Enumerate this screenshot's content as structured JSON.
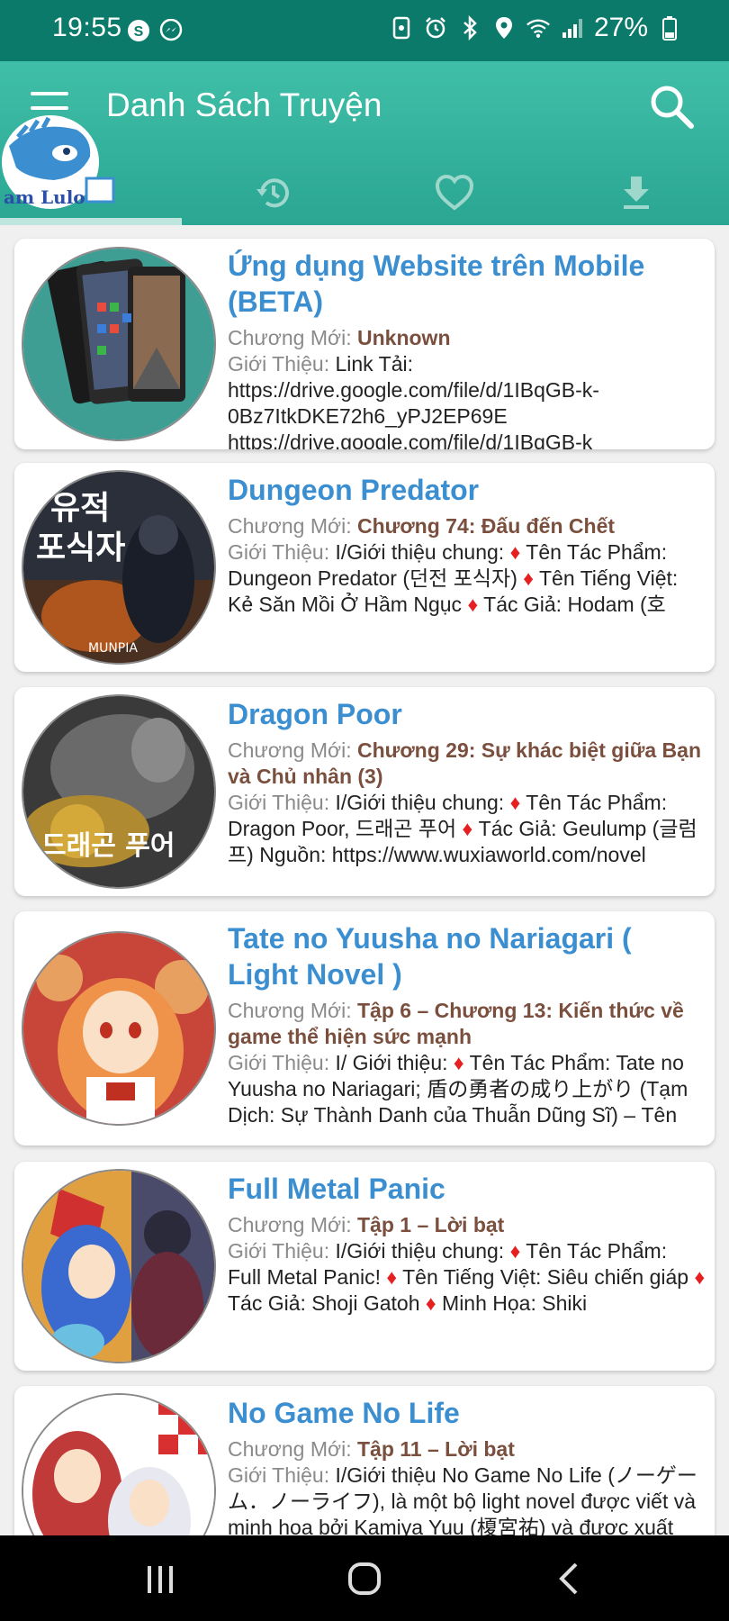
{
  "status_bar": {
    "time": "19:55",
    "battery": "27%",
    "left_icons": [
      "skype-icon",
      "messenger-icon"
    ],
    "right_icons": [
      "vibrate-icon",
      "alarm-icon",
      "bluetooth-icon",
      "location-icon",
      "wifi-icon",
      "signal-icon",
      "battery-icon"
    ]
  },
  "app_bar": {
    "title": "Danh Sách Truyện",
    "logo_text": "am Lulo",
    "tabs": [
      "home-icon",
      "history-icon",
      "favorite-icon",
      "download-icon"
    ]
  },
  "stories": [
    {
      "title": "Ứng dụng Website trên Mobile (BETA)",
      "latest_label": "Chương Mới: ",
      "latest": "Unknown",
      "intro_label": "Giới Thiệu: ",
      "intro": "Link Tải: https://drive.google.com/file/d/1IBqGB-k-0Bz7ItkDKE72h6_yPJ2EP69E https://drive.google.com/file/d/1IBqGB-k"
    },
    {
      "title": "Dungeon Predator",
      "latest_label": "Chương Mới: ",
      "latest": "Chương 74: Đấu đến Chết",
      "intro_label": "Giới Thiệu: ",
      "intro": "I/Giới thiệu chung: ♦ Tên Tác Phẩm: Dungeon Predator (던전 포식자) ♦ Tên Tiếng Việt: Kẻ Săn Mồi Ở Hầm Ngục ♦ Tác Giả: Hodam (호"
    },
    {
      "title": "Dragon Poor",
      "latest_label": "Chương Mới: ",
      "latest": "Chương 29: Sự khác biệt giữa Bạn và Chủ nhân (3)",
      "intro_label": "Giới Thiệu: ",
      "intro": "I/Giới thiệu chung: ♦ Tên Tác Phẩm: Dragon Poor, 드래곤 푸어 ♦ Tác Giả: Geulump (글럼프) Nguồn: https://www.wuxiaworld.com/novel"
    },
    {
      "title": "Tate no Yuusha no Nariagari ( Light Novel )",
      "latest_label": "Chương Mới: ",
      "latest": "Tập 6 – Chương 13: Kiến thức về game thể hiện sức mạnh",
      "intro_label": "Giới Thiệu: ",
      "intro": "I/ Giới thiệu: ♦ Tên Tác Phẩm: Tate no Yuusha no Nariagari; 盾の勇者の成り上がり (Tạm Dịch: Sự Thành Danh của Thuẫn Dũng Sĩ) – Tên"
    },
    {
      "title": "Full Metal Panic",
      "latest_label": "Chương Mới: ",
      "latest": "Tập 1 – Lời bạt",
      "intro_label": "Giới Thiệu: ",
      "intro": "I/Giới thiệu chung: ♦ Tên Tác Phẩm: Full Metal Panic! ♦ Tên Tiếng Việt: Siêu chiến giáp ♦ Tác Giả: Shoji Gatoh ♦ Minh Họa: Shiki"
    },
    {
      "title": "No Game No Life",
      "latest_label": "Chương Mới: ",
      "latest": "Tập 11 – Lời bạt",
      "intro_label": "Giới Thiệu: ",
      "intro": "I/Giới thiệu No Game No Life (ノーゲーム．ノーライフ), là một bộ light novel được viết và minh họa bởi Kamiya Yuu (榎宮祐) và được xuất"
    }
  ],
  "nav_bar": [
    "recents-icon",
    "home-circle-icon",
    "back-icon"
  ],
  "colors": {
    "status_bar": "#0b7a6a",
    "app_bar": "#35b29e",
    "title_blue": "#3b8fd1",
    "latest_brown": "#7a4f3e",
    "diamond_red": "#e62020"
  }
}
